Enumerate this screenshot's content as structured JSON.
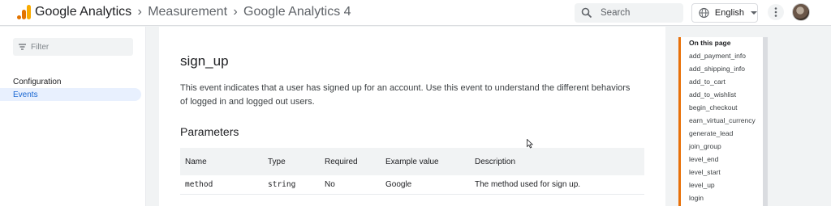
{
  "header": {
    "brand": "Google Analytics",
    "breadcrumbs": [
      "Measurement",
      "Google Analytics 4"
    ],
    "search_placeholder": "Search",
    "language": "English"
  },
  "sidebar": {
    "filter_placeholder": "Filter",
    "items": [
      {
        "label": "Configuration",
        "active": false
      },
      {
        "label": "Events",
        "active": true
      }
    ]
  },
  "main": {
    "title": "sign_up",
    "description": "This event indicates that a user has signed up for an account. Use this event to understand the different behaviors of logged in and logged out users.",
    "params_heading": "Parameters",
    "table": {
      "headers": [
        "Name",
        "Type",
        "Required",
        "Example value",
        "Description"
      ],
      "rows": [
        [
          "method",
          "string",
          "No",
          "Google",
          "The method used for sign up."
        ]
      ]
    }
  },
  "toc": {
    "heading": "On this page",
    "items": [
      "add_payment_info",
      "add_shipping_info",
      "add_to_cart",
      "add_to_wishlist",
      "begin_checkout",
      "earn_virtual_currency",
      "generate_lead",
      "join_group",
      "level_end",
      "level_start",
      "level_up",
      "login"
    ]
  },
  "colors": {
    "accent_orange": "#e8710a",
    "active_blue": "#1967d2",
    "logo_orange": "#f9ab00",
    "logo_dark_orange": "#e37400"
  }
}
